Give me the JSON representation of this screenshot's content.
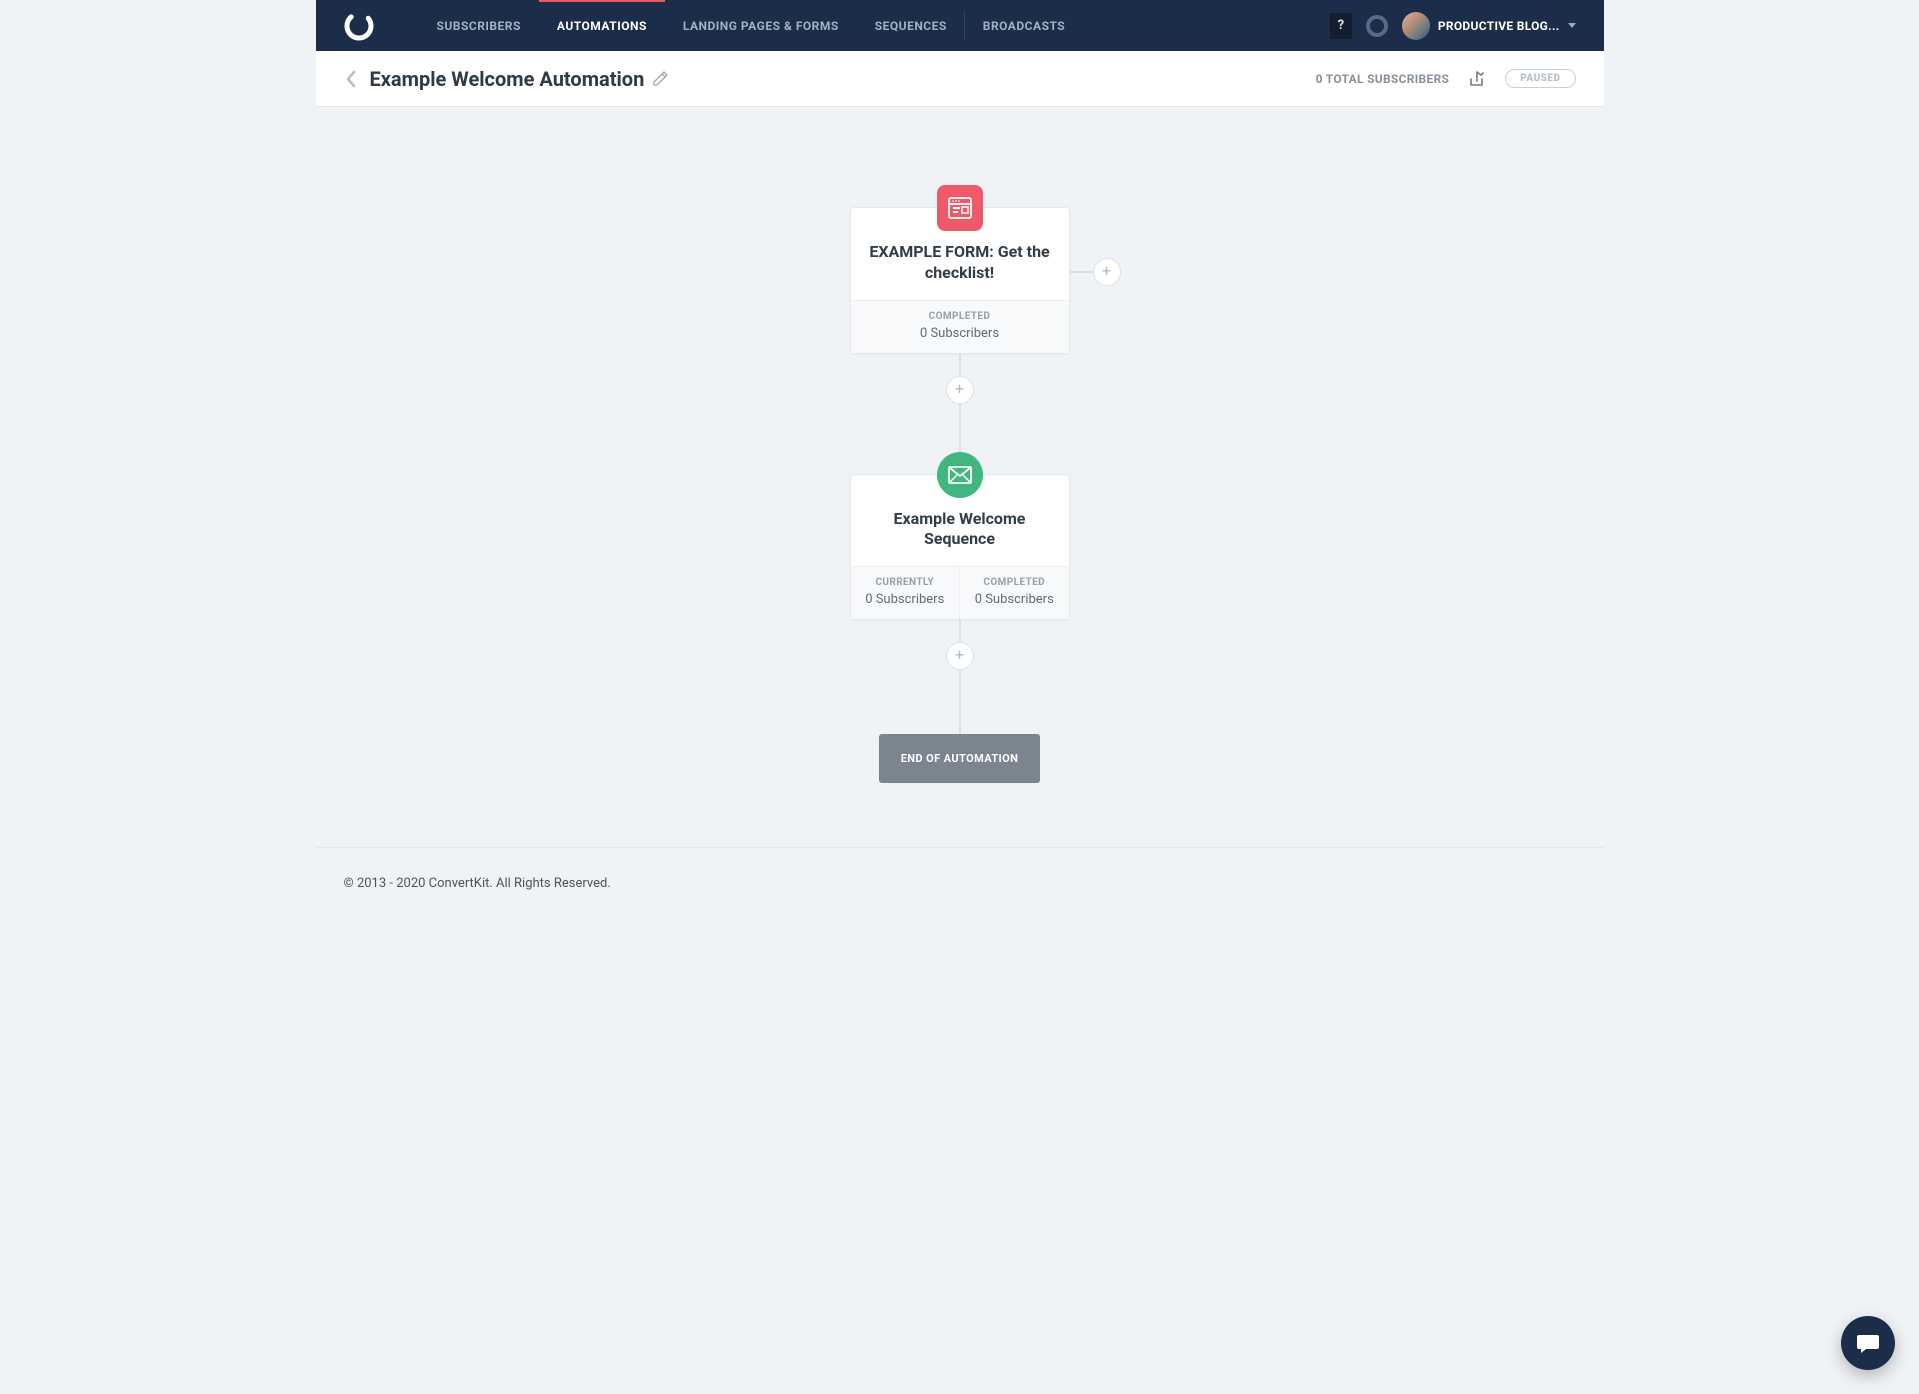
{
  "nav": {
    "items": [
      {
        "label": "SUBSCRIBERS",
        "active": false
      },
      {
        "label": "AUTOMATIONS",
        "active": true
      },
      {
        "label": "LANDING PAGES & FORMS",
        "active": false
      },
      {
        "label": "SEQUENCES",
        "active": false
      },
      {
        "label": "BROADCASTS",
        "active": false
      }
    ],
    "help": "?",
    "account_name": "PRODUCTIVE BLOG..."
  },
  "subheader": {
    "title": "Example Welcome Automation",
    "total_subscribers": "0 TOTAL SUBSCRIBERS",
    "status": "PAUSED"
  },
  "flow": {
    "node1": {
      "title": "EXAMPLE FORM: Get the checklist!",
      "stat1_label": "COMPLETED",
      "stat1_value": "0 Subscribers"
    },
    "node2": {
      "title": "Example Welcome Sequence",
      "stat1_label": "CURRENTLY",
      "stat1_value": "0 Subscribers",
      "stat2_label": "COMPLETED",
      "stat2_value": "0 Subscribers"
    },
    "end_label": "END OF AUTOMATION",
    "plus": "+"
  },
  "footer": {
    "copyright": "© 2013 - 2020 ConvertKit. All Rights Reserved."
  }
}
